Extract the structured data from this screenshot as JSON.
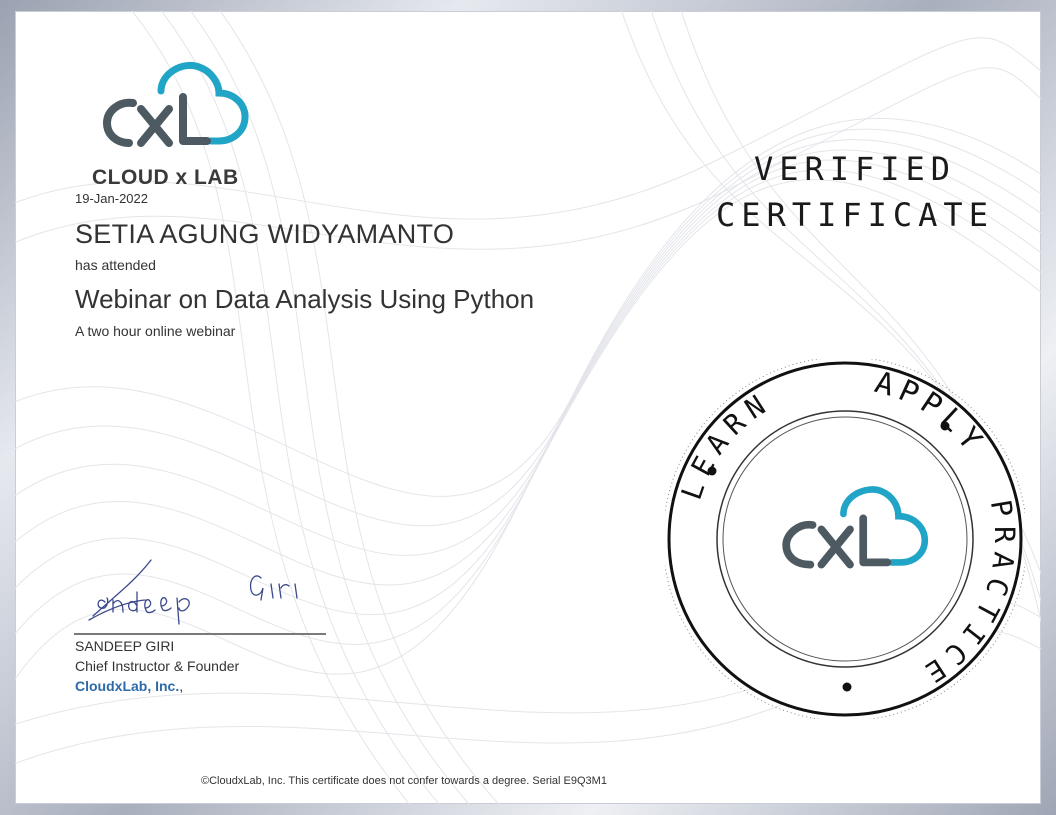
{
  "brand": {
    "name": "CLOUD x LAB",
    "primary_color": "#2f6f8f",
    "accent_color": "#21a5c7",
    "dark_color": "#4d5a62"
  },
  "certificate": {
    "date": "19-Jan-2022",
    "recipient": "SETIA AGUNG WIDYAMANTO",
    "attended_label": "has attended",
    "course_title": "Webinar on Data Analysis Using Python",
    "course_description": "A two hour online webinar",
    "verified_line1": "VERIFIED",
    "verified_line2": "CERTIFICATE"
  },
  "signatory": {
    "signature_text": "Sandeep Giri",
    "name": "SANDEEP GIRI",
    "title": "Chief Instructor & Founder",
    "organization": "CloudxLab, Inc.",
    "org_suffix": ","
  },
  "seal": {
    "word_top": "APPLY",
    "word_right": "PRACTICE",
    "word_left": "LEARN"
  },
  "footer": {
    "text": "©CloudxLab, Inc. This certificate does not confer towards a degree. Serial E9Q3M1"
  }
}
